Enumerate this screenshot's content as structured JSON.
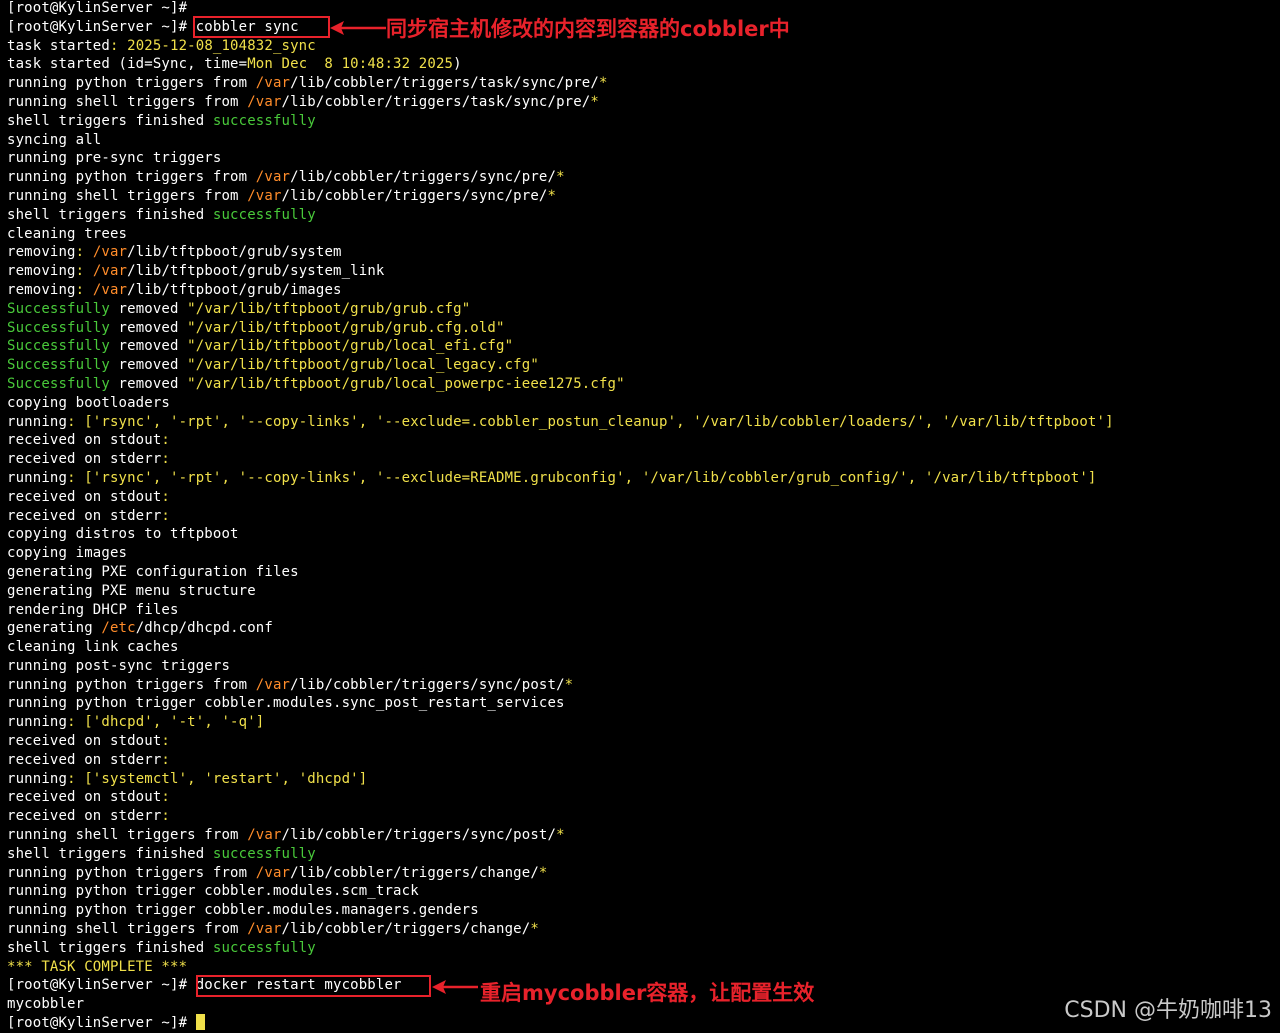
{
  "terminal": {
    "lines": [
      [
        [
          "b",
          "[root@KylinServer ~]#"
        ]
      ],
      [
        [
          "b",
          "[root@KylinServer ~]# cobbler sync"
        ]
      ],
      [
        [
          "b",
          "task started"
        ],
        [
          "y",
          ": 2025-12-08_104832_sync"
        ]
      ],
      [
        [
          "b",
          "task started (id=Sync, time="
        ],
        [
          "y",
          "Mon Dec  8 10:48:32 2025"
        ],
        [
          "b",
          ")"
        ]
      ],
      [
        [
          "b",
          "running python triggers from "
        ],
        [
          "o",
          "/var"
        ],
        [
          "b",
          "/lib/cobbler/triggers/task/sync/pre/"
        ],
        [
          "y",
          "*"
        ]
      ],
      [
        [
          "b",
          "running shell triggers from "
        ],
        [
          "o",
          "/var"
        ],
        [
          "b",
          "/lib/cobbler/triggers/task/sync/pre/"
        ],
        [
          "y",
          "*"
        ]
      ],
      [
        [
          "b",
          "shell triggers finished "
        ],
        [
          "g",
          "successfully"
        ]
      ],
      [
        [
          "b",
          "syncing all"
        ]
      ],
      [
        [
          "b",
          "running pre-sync triggers"
        ]
      ],
      [
        [
          "b",
          "running python triggers from "
        ],
        [
          "o",
          "/var"
        ],
        [
          "b",
          "/lib/cobbler/triggers/sync/pre/"
        ],
        [
          "y",
          "*"
        ]
      ],
      [
        [
          "b",
          "running shell triggers from "
        ],
        [
          "o",
          "/var"
        ],
        [
          "b",
          "/lib/cobbler/triggers/sync/pre/"
        ],
        [
          "y",
          "*"
        ]
      ],
      [
        [
          "b",
          "shell triggers finished "
        ],
        [
          "g",
          "successfully"
        ]
      ],
      [
        [
          "b",
          "cleaning trees"
        ]
      ],
      [
        [
          "b",
          "removing"
        ],
        [
          "y",
          ": "
        ],
        [
          "o",
          "/var"
        ],
        [
          "b",
          "/lib/tftpboot/grub/system"
        ]
      ],
      [
        [
          "b",
          "removing"
        ],
        [
          "y",
          ": "
        ],
        [
          "o",
          "/var"
        ],
        [
          "b",
          "/lib/tftpboot/grub/system_link"
        ]
      ],
      [
        [
          "b",
          "removing"
        ],
        [
          "y",
          ": "
        ],
        [
          "o",
          "/var"
        ],
        [
          "b",
          "/lib/tftpboot/grub/images"
        ]
      ],
      [
        [
          "g",
          "Successfully"
        ],
        [
          "b",
          " removed "
        ],
        [
          "y",
          "\"/var/lib/tftpboot/grub/grub.cfg\""
        ]
      ],
      [
        [
          "g",
          "Successfully"
        ],
        [
          "b",
          " removed "
        ],
        [
          "y",
          "\"/var/lib/tftpboot/grub/grub.cfg.old\""
        ]
      ],
      [
        [
          "g",
          "Successfully"
        ],
        [
          "b",
          " removed "
        ],
        [
          "y",
          "\"/var/lib/tftpboot/grub/local_efi.cfg\""
        ]
      ],
      [
        [
          "g",
          "Successfully"
        ],
        [
          "b",
          " removed "
        ],
        [
          "y",
          "\"/var/lib/tftpboot/grub/local_legacy.cfg\""
        ]
      ],
      [
        [
          "g",
          "Successfully"
        ],
        [
          "b",
          " removed "
        ],
        [
          "y",
          "\"/var/lib/tftpboot/grub/local_powerpc-ieee1275.cfg\""
        ]
      ],
      [
        [
          "b",
          "copying bootloaders"
        ]
      ],
      [
        [
          "b",
          "running"
        ],
        [
          "y",
          ": ['rsync', '-rpt', '--copy-links', '--exclude=.cobbler_postun_cleanup', '/var/lib/cobbler/loaders/', '/var/lib/tftpboot']"
        ]
      ],
      [
        [
          "b",
          "received on stdout"
        ],
        [
          "y",
          ":"
        ]
      ],
      [
        [
          "b",
          "received on stderr"
        ],
        [
          "y",
          ":"
        ]
      ],
      [
        [
          "b",
          "running"
        ],
        [
          "y",
          ": ['rsync', '-rpt', '--copy-links', '--exclude=README.grubconfig', '/var/lib/cobbler/grub_config/', '/var/lib/tftpboot']"
        ]
      ],
      [
        [
          "b",
          "received on stdout"
        ],
        [
          "y",
          ":"
        ]
      ],
      [
        [
          "b",
          "received on stderr"
        ],
        [
          "y",
          ":"
        ]
      ],
      [
        [
          "b",
          "copying distros to tftpboot"
        ]
      ],
      [
        [
          "b",
          "copying images"
        ]
      ],
      [
        [
          "b",
          "generating PXE configuration files"
        ]
      ],
      [
        [
          "b",
          "generating PXE menu structure"
        ]
      ],
      [
        [
          "b",
          "rendering DHCP files"
        ]
      ],
      [
        [
          "b",
          "generating "
        ],
        [
          "o",
          "/etc"
        ],
        [
          "b",
          "/dhcp/dhcpd.conf"
        ]
      ],
      [
        [
          "b",
          "cleaning link caches"
        ]
      ],
      [
        [
          "b",
          "running post-sync triggers"
        ]
      ],
      [
        [
          "b",
          "running python triggers from "
        ],
        [
          "o",
          "/var"
        ],
        [
          "b",
          "/lib/cobbler/triggers/sync/post/"
        ],
        [
          "y",
          "*"
        ]
      ],
      [
        [
          "b",
          "running python trigger cobbler.modules.sync_post_restart_services"
        ]
      ],
      [
        [
          "b",
          "running"
        ],
        [
          "y",
          ": ['dhcpd', '-t', '-q']"
        ]
      ],
      [
        [
          "b",
          "received on stdout"
        ],
        [
          "y",
          ":"
        ]
      ],
      [
        [
          "b",
          "received on stderr"
        ],
        [
          "y",
          ":"
        ]
      ],
      [
        [
          "b",
          "running"
        ],
        [
          "y",
          ": ['systemctl', 'restart', 'dhcpd']"
        ]
      ],
      [
        [
          "b",
          "received on stdout"
        ],
        [
          "y",
          ":"
        ]
      ],
      [
        [
          "b",
          "received on stderr"
        ],
        [
          "y",
          ":"
        ]
      ],
      [
        [
          "b",
          "running shell triggers from "
        ],
        [
          "o",
          "/var"
        ],
        [
          "b",
          "/lib/cobbler/triggers/sync/post/"
        ],
        [
          "y",
          "*"
        ]
      ],
      [
        [
          "b",
          "shell triggers finished "
        ],
        [
          "g",
          "successfully"
        ]
      ],
      [
        [
          "b",
          "running python triggers from "
        ],
        [
          "o",
          "/var"
        ],
        [
          "b",
          "/lib/cobbler/triggers/change/"
        ],
        [
          "y",
          "*"
        ]
      ],
      [
        [
          "b",
          "running python trigger cobbler.modules.scm_track"
        ]
      ],
      [
        [
          "b",
          "running python trigger cobbler.modules.managers.genders"
        ]
      ],
      [
        [
          "b",
          "running shell triggers from "
        ],
        [
          "o",
          "/var"
        ],
        [
          "b",
          "/lib/cobbler/triggers/change/"
        ],
        [
          "y",
          "*"
        ]
      ],
      [
        [
          "b",
          "shell triggers finished "
        ],
        [
          "g",
          "successfully"
        ]
      ],
      [
        [
          "y",
          "*** TASK COMPLETE ***"
        ]
      ],
      [
        [
          "b",
          "[root@KylinServer ~]# docker restart mycobbler"
        ]
      ],
      [
        [
          "b",
          "mycobbler"
        ]
      ],
      [
        [
          "b",
          "[root@KylinServer ~]# "
        ]
      ]
    ],
    "cursor_line": 54
  },
  "annotations": {
    "sync_note": "同步宿主机修改的内容到容器的cobbler中",
    "restart_note": "重启mycobbler容器，让配置生效"
  },
  "watermark": "CSDN @牛奶咖啡13",
  "colors": {
    "annotation_red": "#e8222b",
    "yellow": "#f0e04a",
    "green": "#49c93a",
    "orange": "#ff8c2a",
    "purple": "#b38dff"
  }
}
